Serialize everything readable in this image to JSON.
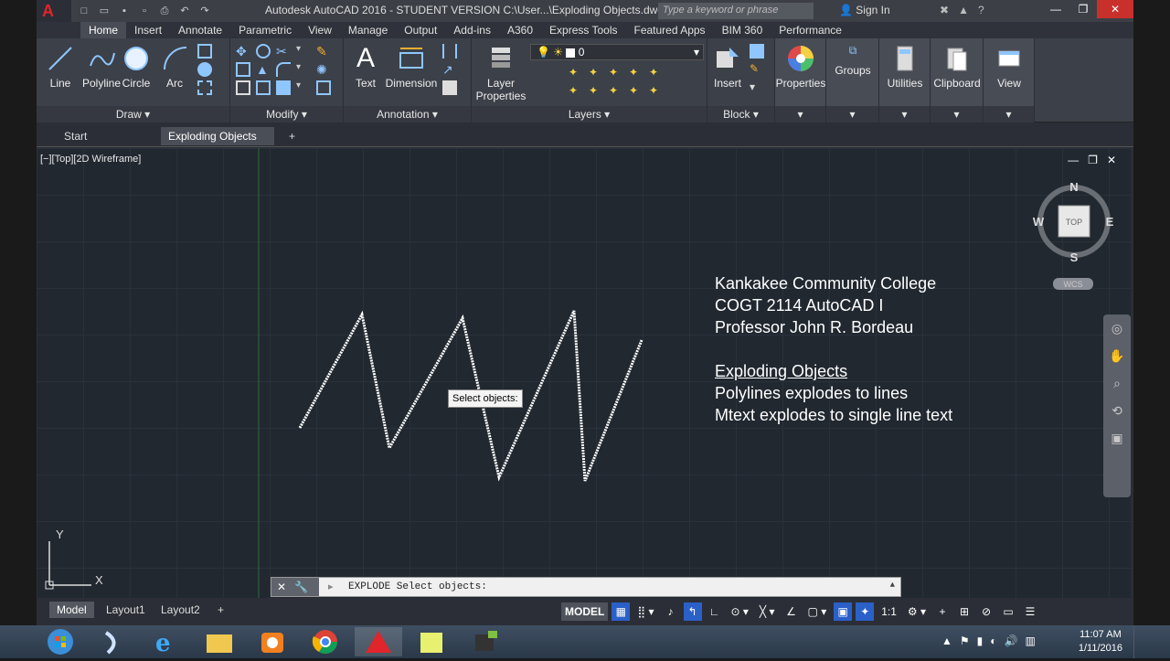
{
  "titlebar": {
    "title": "Autodesk AutoCAD 2016 - STUDENT VERSION    C:\\User...\\Exploding Objects.dwg",
    "search_placeholder": "Type a keyword or phrase",
    "signin_label": "Sign In",
    "logo": "A"
  },
  "ribbon_tabs": [
    "Home",
    "Insert",
    "Annotate",
    "Parametric",
    "View",
    "Manage",
    "Output",
    "Add-ins",
    "A360",
    "Express Tools",
    "Featured Apps",
    "BIM 360",
    "Performance"
  ],
  "panels": {
    "draw": {
      "title": "Draw ▾",
      "buttons": [
        "Line",
        "Polyline",
        "Circle",
        "Arc"
      ]
    },
    "modify": {
      "title": "Modify ▾"
    },
    "annotation": {
      "title": "Annotation ▾",
      "buttons": [
        "Text",
        "Dimension"
      ]
    },
    "layers": {
      "title": "Layers ▾",
      "layer_properties": "Layer Properties",
      "current_layer": "0"
    },
    "block": {
      "title": "Block ▾",
      "insert": "Insert"
    },
    "properties": "Properties",
    "groups": "Groups",
    "utilities": "Utilities",
    "clipboard": "Clipboard",
    "view": "View"
  },
  "doc_tabs": {
    "start": "Start",
    "active": "Exploding Objects",
    "close": "✕",
    "add": "+"
  },
  "viewport": {
    "label": "[−][Top][2D Wireframe]",
    "compass": {
      "n": "N",
      "s": "S",
      "e": "E",
      "w": "W",
      "top": "TOP",
      "wcs": "WCS"
    },
    "ucs_x": "X",
    "ucs_y": "Y"
  },
  "drawing_text": {
    "line1": "Kankakee Community College",
    "line2": "COGT 2114  AutoCAD I",
    "line3": "Professor John R. Bordeau",
    "heading": "Exploding Objects",
    "line4": "Polylines explodes to lines",
    "line5": "Mtext explodes to single line text"
  },
  "tooltip": "Select objects:",
  "command_line": {
    "prompt": "EXPLODE Select objects:"
  },
  "layout_tabs": [
    "Model",
    "Layout1",
    "Layout2"
  ],
  "status": {
    "model": "MODEL",
    "scale": "1:1"
  },
  "taskbar": {
    "time": "11:07 AM",
    "date": "1/11/2016"
  },
  "colors": {
    "accent": "#2a60c8",
    "autocad_red": "#e0252b",
    "canvas": "#212830"
  }
}
